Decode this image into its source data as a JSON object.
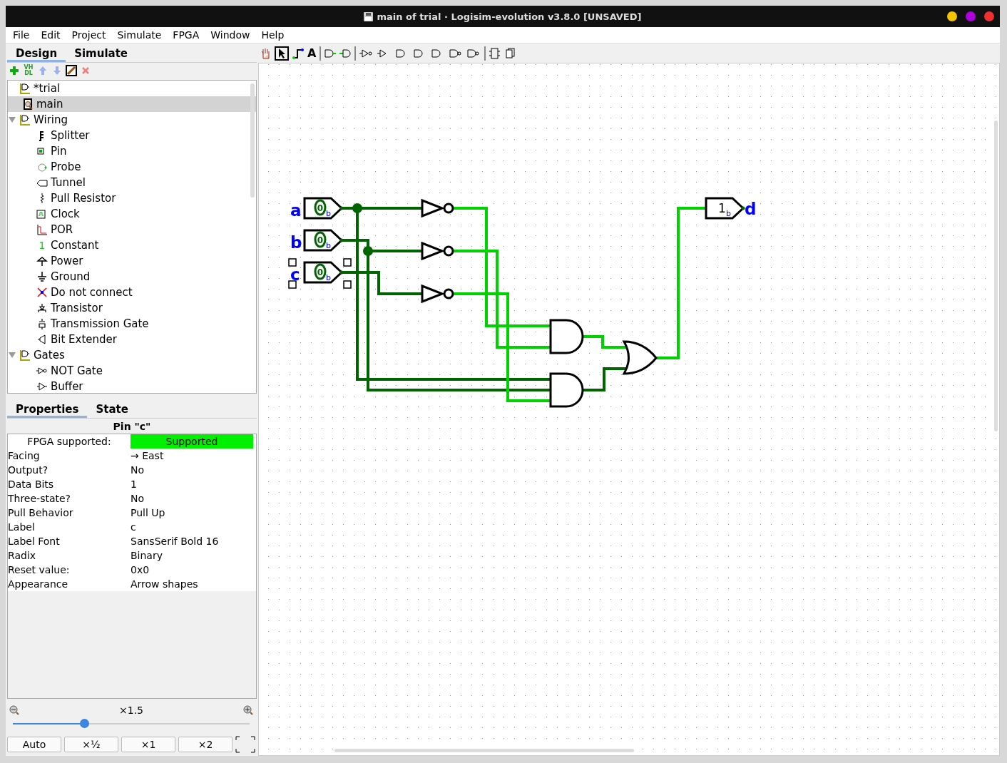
{
  "window": {
    "title": "main of trial · Logisim-evolution v3.8.0 [UNSAVED]"
  },
  "menu": [
    "File",
    "Edit",
    "Project",
    "Simulate",
    "FPGA",
    "Window",
    "Help"
  ],
  "side_tabs": [
    {
      "label": "Design",
      "selected": true
    },
    {
      "label": "Simulate",
      "selected": false
    }
  ],
  "toolbar": {
    "text_tool": "A"
  },
  "side_toolbar": {
    "vhdl": "VH DL"
  },
  "tree": {
    "project": {
      "label": "*trial",
      "children": [
        {
          "label": "main",
          "selected": true
        }
      ]
    },
    "libraries": [
      {
        "label": "Wiring",
        "expanded": true,
        "children": [
          {
            "label": "Splitter",
            "kind": "splitter"
          },
          {
            "label": "Pin",
            "kind": "pin"
          },
          {
            "label": "Probe",
            "kind": "probe"
          },
          {
            "label": "Tunnel",
            "kind": "tunnel"
          },
          {
            "label": "Pull Resistor",
            "kind": "resistor"
          },
          {
            "label": "Clock",
            "kind": "clock"
          },
          {
            "label": "POR",
            "kind": "por"
          },
          {
            "label": "Constant",
            "kind": "constant",
            "icon_text": "1"
          },
          {
            "label": "Power",
            "kind": "power"
          },
          {
            "label": "Ground",
            "kind": "ground"
          },
          {
            "label": "Do not connect",
            "kind": "noconnect"
          },
          {
            "label": "Transistor",
            "kind": "transistor"
          },
          {
            "label": "Transmission Gate",
            "kind": "tgate"
          },
          {
            "label": "Bit Extender",
            "kind": "extender"
          }
        ]
      },
      {
        "label": "Gates",
        "expanded": true,
        "children": [
          {
            "label": "NOT Gate",
            "kind": "not"
          },
          {
            "label": "Buffer",
            "kind": "buffer"
          }
        ]
      }
    ]
  },
  "prop_tabs": [
    {
      "label": "Properties",
      "selected": true
    },
    {
      "label": "State",
      "selected": false
    }
  ],
  "properties": {
    "title": "Pin \"c\"",
    "fpga": {
      "label": "FPGA supported:",
      "value": "Supported",
      "supported": true
    },
    "rows": [
      {
        "name": "Facing",
        "value": "→ East"
      },
      {
        "name": "Output?",
        "value": "No"
      },
      {
        "name": "Data Bits",
        "value": "1"
      },
      {
        "name": "Three-state?",
        "value": "No"
      },
      {
        "name": "Pull Behavior",
        "value": "Pull Up"
      },
      {
        "name": "Label",
        "value": "c"
      },
      {
        "name": "Label Font",
        "value": "SansSerif Bold 16"
      },
      {
        "name": "Radix",
        "value": "Binary"
      },
      {
        "name": "Reset value:",
        "value": "0x0"
      },
      {
        "name": "Appearance",
        "value": "Arrow shapes"
      }
    ]
  },
  "zoom": {
    "reading": "×1.5",
    "level": 0.3,
    "buttons": [
      "Auto",
      "×½",
      "×1",
      "×2"
    ]
  },
  "circuit": {
    "inputs": [
      {
        "label": "a",
        "value": "0",
        "radix": "b",
        "selected": false
      },
      {
        "label": "b",
        "value": "0",
        "radix": "b",
        "selected": false
      },
      {
        "label": "c",
        "value": "0",
        "radix": "b",
        "selected": true
      }
    ],
    "output": {
      "label": "d",
      "value": "1",
      "radix": "b"
    },
    "nets": [
      {
        "high": false
      },
      {
        "high": false
      },
      {
        "high": false
      },
      {
        "high": true
      },
      {
        "high": true
      },
      {
        "high": true
      },
      {
        "high": true
      },
      {
        "high": false
      },
      {
        "high": true
      }
    ]
  }
}
